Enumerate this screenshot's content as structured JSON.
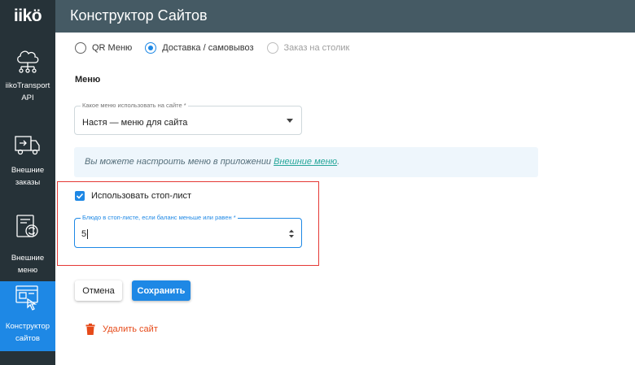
{
  "app": {
    "logo": "iikö",
    "title": "Конструктор Сайтов"
  },
  "sidebar": {
    "items": [
      {
        "label": "iikoTransport API",
        "icon": "cloud-network-icon",
        "active": false
      },
      {
        "label": "Внешние заказы",
        "icon": "delivery-truck-icon",
        "active": false
      },
      {
        "label": "Внешние меню",
        "icon": "menu-sync-icon",
        "active": false
      },
      {
        "label": "Конструктор сайтов",
        "icon": "website-builder-icon",
        "active": true
      }
    ]
  },
  "order_type": {
    "options": [
      {
        "label": "QR Меню",
        "checked": false,
        "disabled": false
      },
      {
        "label": "Доставка / самовывоз",
        "checked": true,
        "disabled": false
      },
      {
        "label": "Заказ на столик",
        "checked": false,
        "disabled": true
      }
    ]
  },
  "menu_section": {
    "title": "Меню",
    "select_label": "Какое меню использовать на сайте *",
    "select_value": "Настя — меню для сайта"
  },
  "info": {
    "text": "Вы можете настроить меню в приложении ",
    "link": "Внешние меню",
    "suffix": "."
  },
  "stoplist": {
    "checkbox_label": "Использовать стоп-лист",
    "checked": true,
    "field_label": "Блюдо в стоп-листе, если баланс меньше или равен *",
    "field_value": "5"
  },
  "actions": {
    "cancel": "Отмена",
    "save": "Сохранить",
    "delete": "Удалить сайт"
  },
  "colors": {
    "sidebar": "#263238",
    "header": "#455a64",
    "accent": "#1e88e5",
    "danger": "#e64a19",
    "highlight_border": "#e53935"
  }
}
